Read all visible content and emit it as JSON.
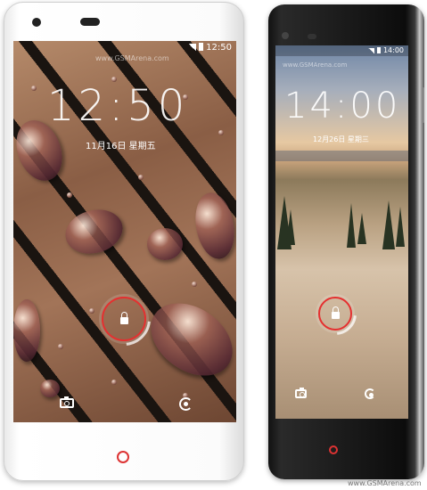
{
  "watermark_bottom": "www.GSMArena.com",
  "phone_left": {
    "status_time": "12:50",
    "clock": "12:50",
    "date": "11月16日 星期五",
    "watermark": "www.GSMArena.com",
    "lock_icon": "lock-icon",
    "camera_icon": "camera-icon",
    "swirl_icon": "swirl-icon",
    "accent_color": "#e53030"
  },
  "phone_right": {
    "status_time": "14:00",
    "clock": "14:00",
    "date": "12月26日 星期三",
    "watermark": "www.GSMArena.com",
    "lock_icon": "lock-icon",
    "camera_icon": "camera-icon",
    "swirl_icon": "swirl-icon",
    "accent_color": "#e53030"
  }
}
